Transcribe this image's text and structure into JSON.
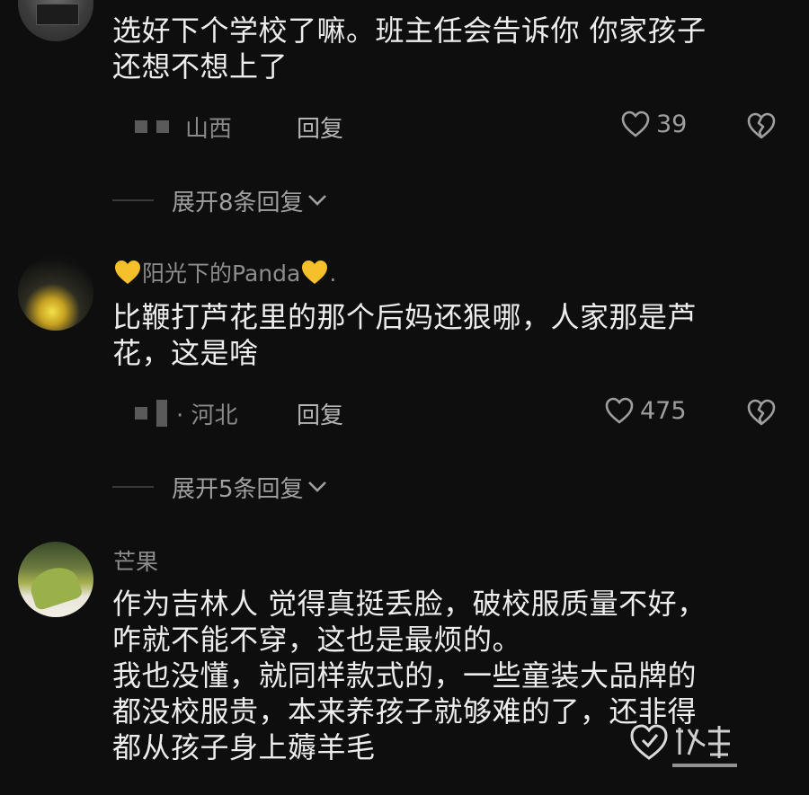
{
  "comments": [
    {
      "username": "",
      "text_lines": [
        "选好下个学校了嘛。班主任会告诉你 你家孩子",
        "还想不想上了"
      ],
      "location": "山西",
      "reply_label": "回复",
      "likes": "39",
      "expand_label": "展开8条回复"
    },
    {
      "username": "阳光下的Panda",
      "username_suffix": ".",
      "text_lines": [
        "比鞭打芦花里的那个后妈还狠哪，人家那是芦",
        "花，这是啥"
      ],
      "location": "· 河北",
      "reply_label": "回复",
      "likes": "475",
      "expand_label": "展开5条回复"
    },
    {
      "username": "芒果",
      "text_lines": [
        "作为吉林人 觉得真挺丢脸，破校服质量不好，",
        "咋就不能不穿，这也是最烦的。",
        "我也没懂，就同样款式的，一些童装大品牌的",
        "都没校服贵，本来养孩子就够难的了，还非得",
        "都从孩子身上薅羊毛"
      ]
    }
  ],
  "colors": {
    "background": "#0e0e0e",
    "text": "#ededed",
    "muted": "#8a8a8a",
    "emoji_heart": "#f5c02a"
  },
  "icons": [
    "avatar",
    "heart-outline-icon",
    "broken-heart-icon",
    "chevron-down-icon",
    "yellow-heart-emoji",
    "watermark-logo"
  ]
}
